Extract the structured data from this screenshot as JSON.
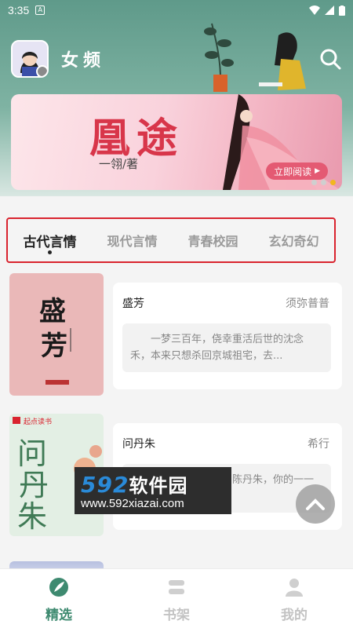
{
  "status_bar": {
    "time": "3:35",
    "notification_icon": "a-notification-icon"
  },
  "header": {
    "channel_title": "女频",
    "avatar_icon": "girl-avatar-icon",
    "search_icon": "search-icon"
  },
  "banner": {
    "title": "凰途",
    "author": "一翎/著",
    "read_button": "立即阅读",
    "active_dot": 2,
    "dot_count": 3
  },
  "category_tabs": [
    {
      "label": "古代言情",
      "active": true
    },
    {
      "label": "现代言情",
      "active": false
    },
    {
      "label": "青春校园",
      "active": false
    },
    {
      "label": "玄幻奇幻",
      "active": false
    }
  ],
  "books": [
    {
      "title": "盛芳",
      "author": "须弥普普",
      "description": "一梦三百年，侥幸重活后世的沈念禾，本来只想杀回京城祖宅，去...",
      "cover_title": "盛芳",
      "cover_color": "#eab8b8"
    },
    {
      "title": "问丹朱",
      "author": "希行",
      "description": "一问陈丹朱，你的一一简体实体...",
      "cover_title": "问丹朱",
      "cover_badge": "起点读书",
      "cover_color": "#e3efe4"
    }
  ],
  "watermark": {
    "brand": "592",
    "brand_cn": "软件园",
    "url": "www.592xiazai.com"
  },
  "bottom_nav": [
    {
      "label": "精选",
      "icon": "feather-icon",
      "active": true
    },
    {
      "label": "书架",
      "icon": "bookshelf-icon",
      "active": false
    },
    {
      "label": "我的",
      "icon": "person-icon",
      "active": false
    }
  ],
  "colors": {
    "accent": "#3e8a70",
    "highlight_border": "#d9232e",
    "banner_button": "#e45a73"
  }
}
